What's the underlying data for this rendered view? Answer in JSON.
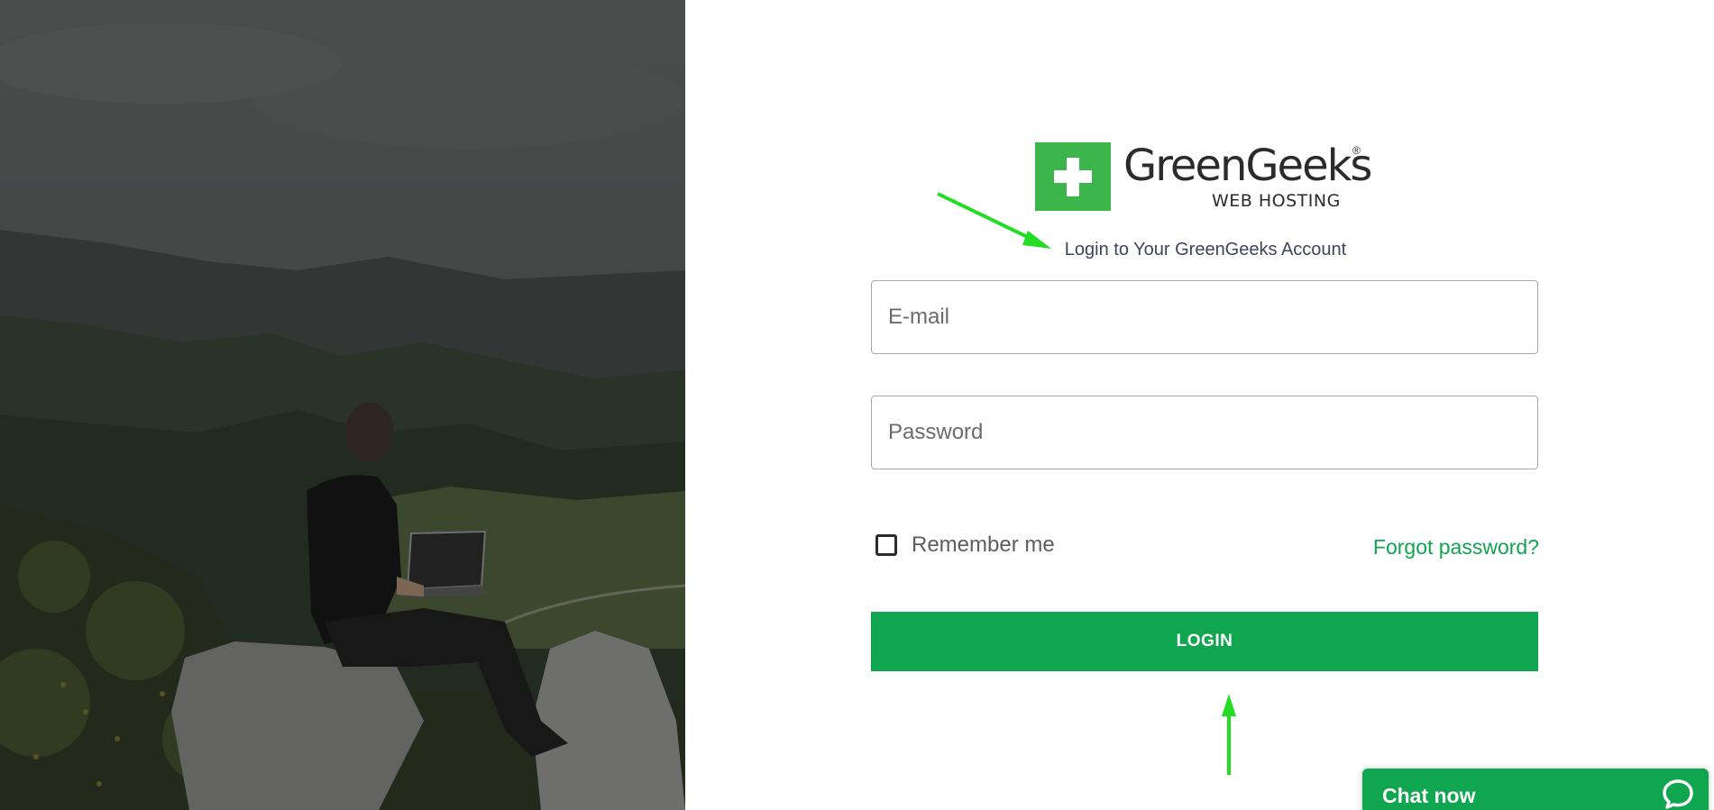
{
  "brand": {
    "name": "GreenGeeks",
    "registered_mark": "®",
    "tagline": "WEB HOSTING",
    "logo_color": "#3cb54a"
  },
  "login": {
    "heading": "Login to Your GreenGeeks Account",
    "email_placeholder": "E-mail",
    "password_placeholder": "Password",
    "remember_label": "Remember me",
    "remember_checked": false,
    "forgot_label": "Forgot password?",
    "submit_label": "LOGIN"
  },
  "chat": {
    "label": "Chat now",
    "icon": "chat-bubble-icon"
  },
  "colors": {
    "accent": "#10a64f",
    "annotation_arrow": "#22dd22",
    "heading_text": "#3e4459"
  },
  "background_image": {
    "subject": "person-with-laptop-on-mountain-rock"
  }
}
